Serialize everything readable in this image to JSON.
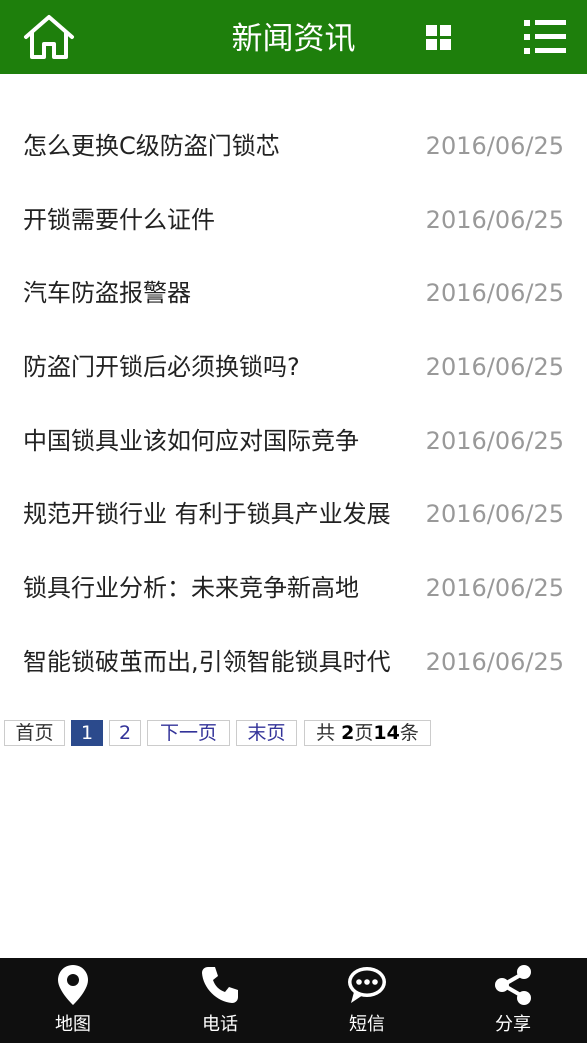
{
  "header": {
    "title": "新闻资讯",
    "bg_color": "#1e7f0c",
    "left_icon": "home-icon",
    "grid_icon": "grid-icon",
    "menu_icon": "menu-list-icon"
  },
  "news": [
    {
      "title": "怎么更换C级防盗门锁芯",
      "date": "2016/06/25"
    },
    {
      "title": "开锁需要什么证件",
      "date": "2016/06/25"
    },
    {
      "title": "汽车防盗报警器",
      "date": "2016/06/25"
    },
    {
      "title": "防盗门开锁后必须换锁吗?",
      "date": "2016/06/25"
    },
    {
      "title": "中国锁具业该如何应对国际竞争",
      "date": "2016/06/25"
    },
    {
      "title": "规范开锁行业 有利于锁具产业发展",
      "date": "2016/06/25"
    },
    {
      "title": "锁具行业分析：未来竞争新高地",
      "date": "2016/06/25"
    },
    {
      "title": "智能锁破茧而出,引领智能锁具时代",
      "date": "2016/06/25"
    }
  ],
  "pager": {
    "first": "首页",
    "page1": "1",
    "page2": "2",
    "next": "下一页",
    "last": "末页",
    "total_prefix": "共 ",
    "total_pages": "2",
    "pages_word": "页",
    "total_items": "14",
    "items_word": "条",
    "current_color": "#2b4a8c"
  },
  "footer": {
    "items": [
      {
        "label": "地图",
        "icon": "map-pin-icon"
      },
      {
        "label": "电话",
        "icon": "phone-icon"
      },
      {
        "label": "短信",
        "icon": "sms-icon"
      },
      {
        "label": "分享",
        "icon": "share-icon"
      }
    ]
  }
}
